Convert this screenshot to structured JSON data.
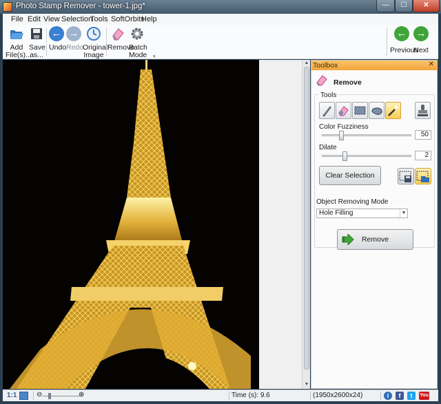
{
  "window": {
    "title": "Photo Stamp Remover - tower-1.jpg*",
    "min_glyph": "—",
    "max_glyph": "☐",
    "close_glyph": "✕"
  },
  "menu": [
    "File",
    "Edit",
    "View",
    "Selection",
    "Tools",
    "SoftOrbits",
    "Help"
  ],
  "toolbar": {
    "add_files": "Add File(s)...",
    "save_as": "Save as...",
    "undo": "Undo",
    "redo": "Redo",
    "original_image": "Original Image",
    "remove": "Remove",
    "batch_mode": "Batch Mode",
    "previous": "Previous",
    "next": "Next"
  },
  "toolbox": {
    "header": "Toolbox",
    "close_glyph": "✕",
    "title": "Remove",
    "tools_label": "Tools",
    "tools": [
      "pencil-icon",
      "eraser-icon",
      "rect-select-icon",
      "lasso-icon",
      "magic-wand-icon",
      "stamp-icon"
    ],
    "active_tool": "magic-wand-icon",
    "color_fuzziness_label": "Color Fuzziness",
    "color_fuzziness_value": "50",
    "color_fuzziness_fraction": 0.2,
    "dilate_label": "Dilate",
    "dilate_value": "2",
    "dilate_fraction": 0.24,
    "clear_selection": "Clear Selection",
    "object_mode_label": "Object Removing Mode",
    "object_mode_value": "Hole Filling",
    "remove_button": "Remove"
  },
  "statusbar": {
    "zoom_label": "1:1",
    "time": "Time (s): 9.6",
    "dimensions": "(1950x2600x24)"
  },
  "colors": {
    "accent_orange": "#f3a33a",
    "nav_green": "#3fa53a",
    "undo_blue": "#3a7fd0"
  }
}
